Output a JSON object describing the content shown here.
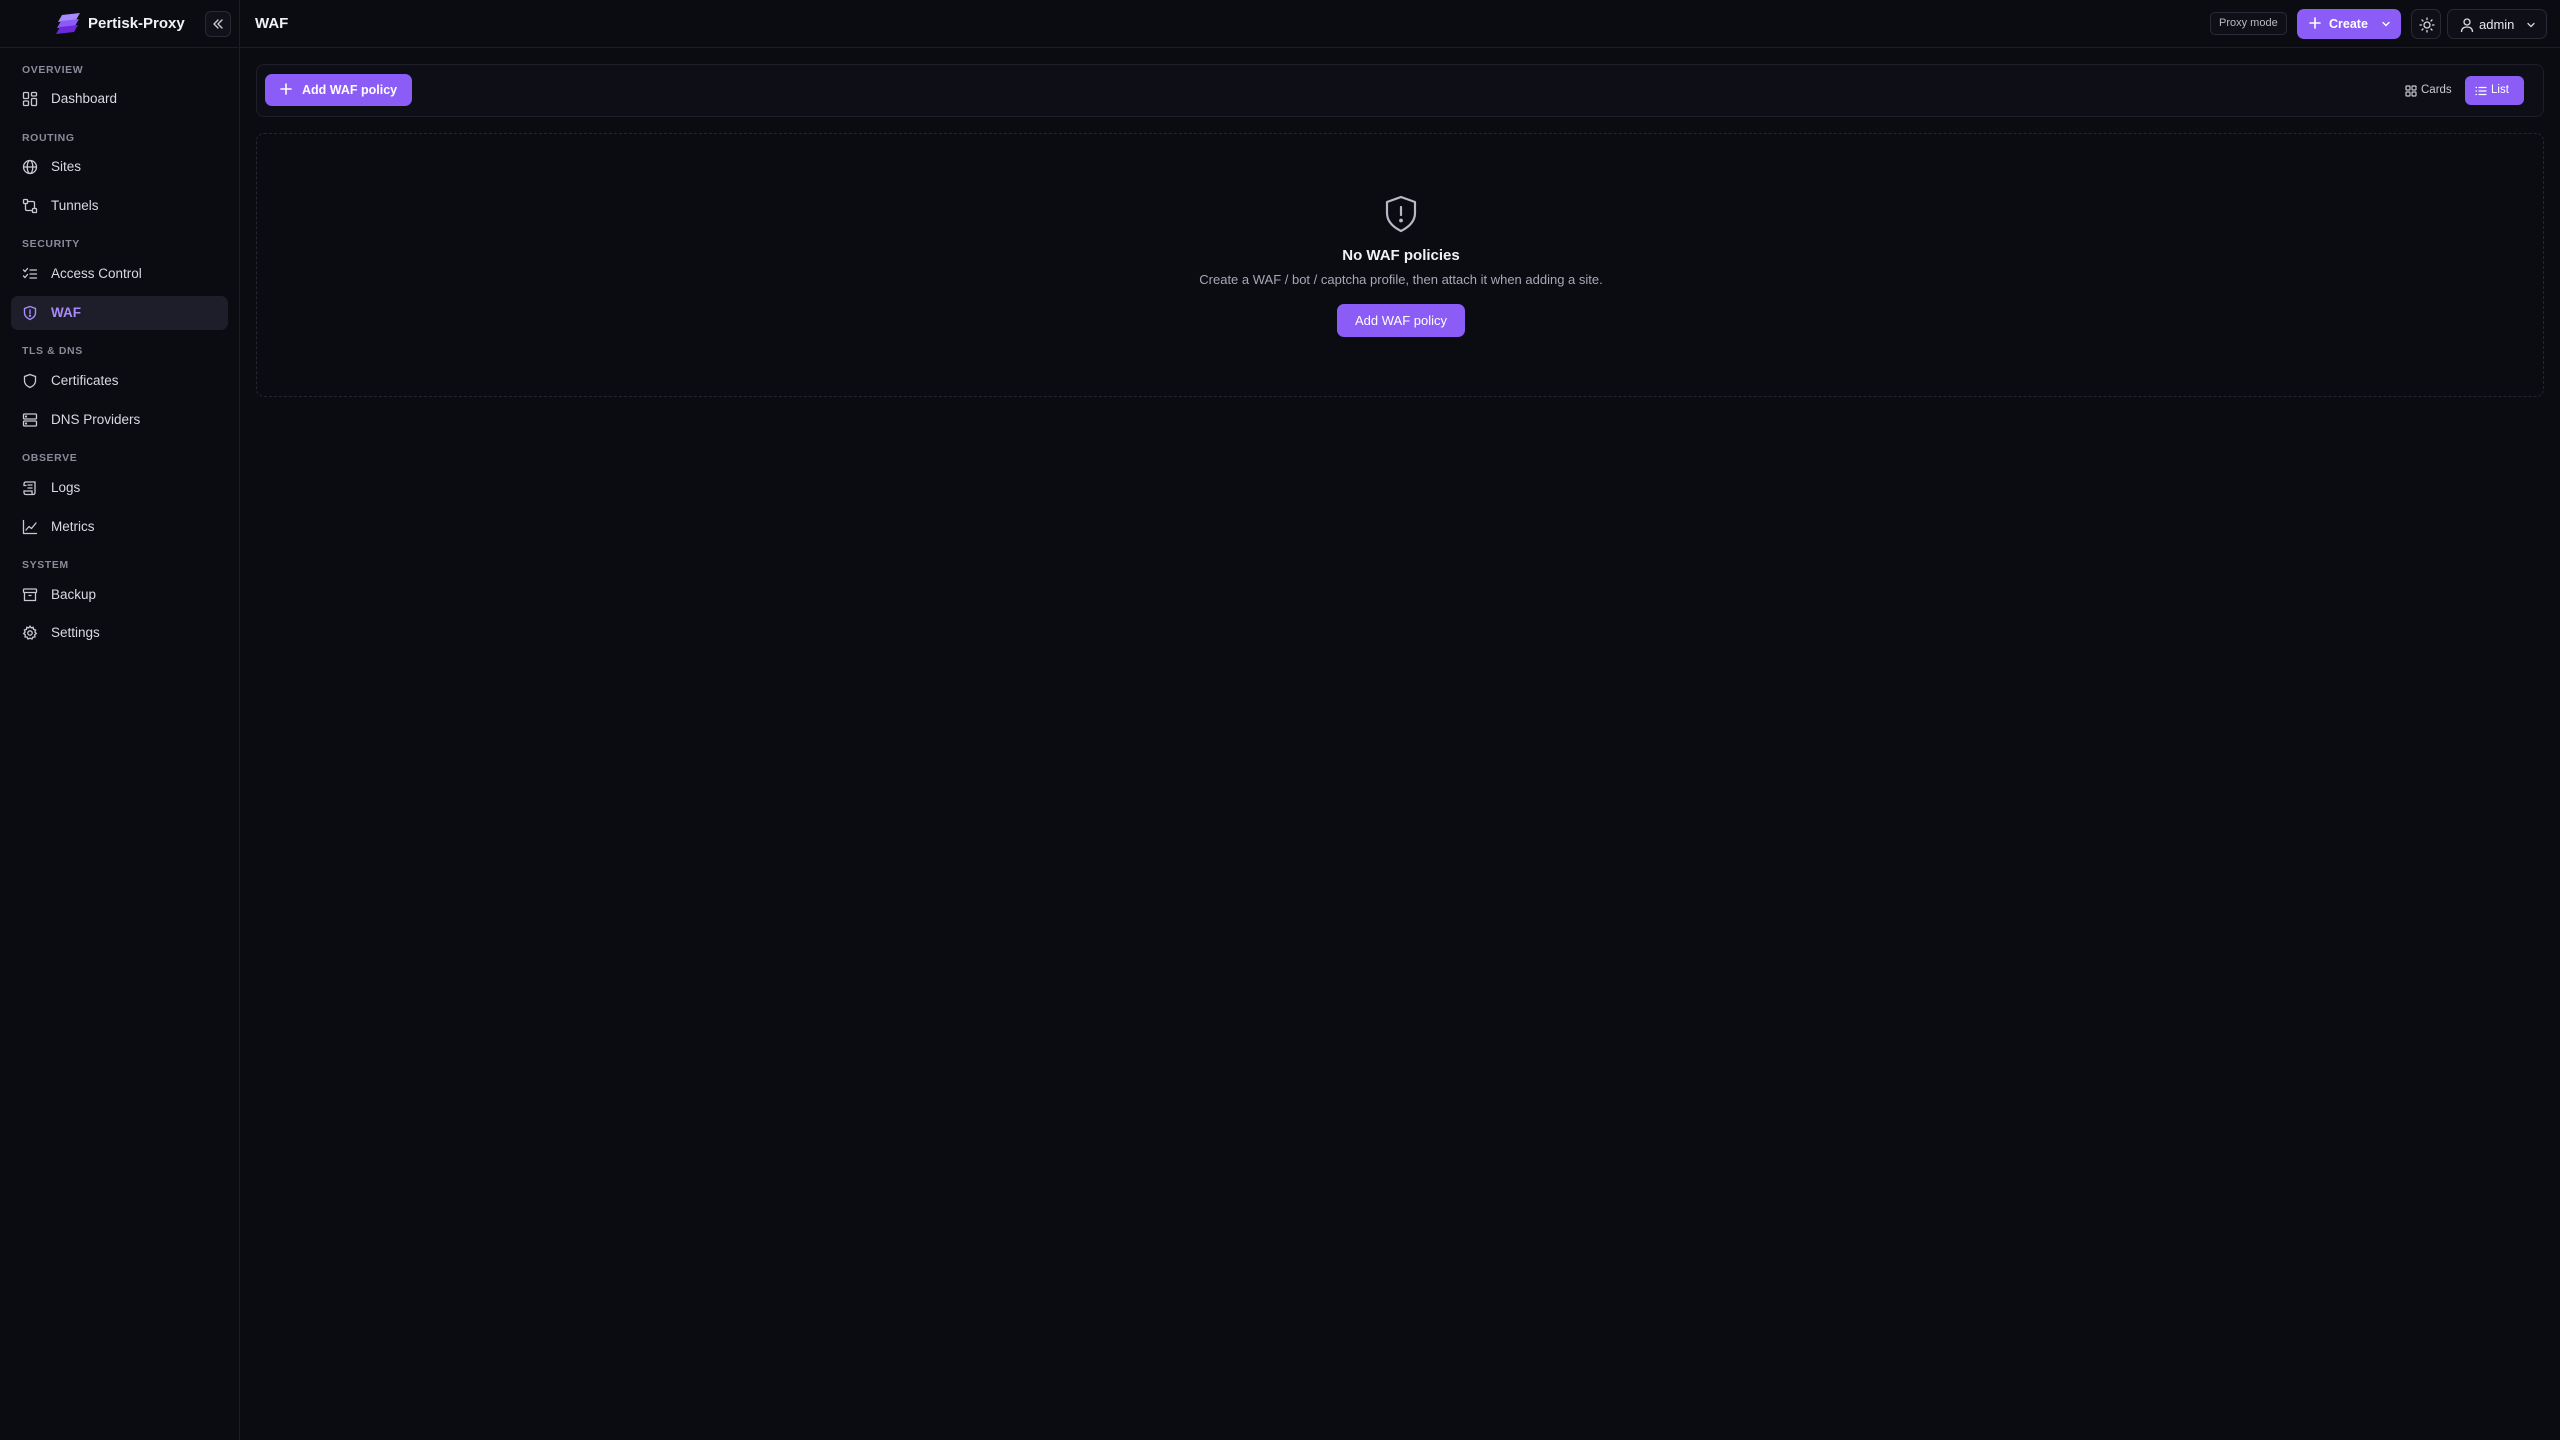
{
  "app": {
    "name": "Pertisk-Proxy"
  },
  "header": {
    "title": "WAF",
    "proxy_mode": "Proxy mode",
    "create_label": "Create",
    "user": "admin"
  },
  "sidebar": {
    "sections": [
      {
        "label": "OVERVIEW",
        "items": [
          {
            "label": "Dashboard",
            "icon": "dashboard-icon"
          }
        ]
      },
      {
        "label": "ROUTING",
        "items": [
          {
            "label": "Sites",
            "icon": "globe-icon"
          },
          {
            "label": "Tunnels",
            "icon": "tunnel-icon"
          }
        ]
      },
      {
        "label": "SECURITY",
        "items": [
          {
            "label": "Access Control",
            "icon": "list-checks-icon"
          },
          {
            "label": "WAF",
            "icon": "shield-icon",
            "active": true
          }
        ]
      },
      {
        "label": "TLS & DNS",
        "items": [
          {
            "label": "Certificates",
            "icon": "shield-outline-icon"
          },
          {
            "label": "DNS Providers",
            "icon": "server-icon"
          }
        ]
      },
      {
        "label": "OBSERVE",
        "items": [
          {
            "label": "Logs",
            "icon": "scroll-icon"
          },
          {
            "label": "Metrics",
            "icon": "line-chart-icon"
          }
        ]
      },
      {
        "label": "SYSTEM",
        "items": [
          {
            "label": "Backup",
            "icon": "archive-icon"
          },
          {
            "label": "Settings",
            "icon": "gear-icon"
          }
        ]
      }
    ]
  },
  "toolbar": {
    "add_label": "Add WAF policy",
    "view_cards": "Cards",
    "view_list": "List",
    "active_view": "List"
  },
  "empty_state": {
    "title": "No WAF policies",
    "description": "Create a WAF / bot / captcha profile, then attach it when adding a site.",
    "button": "Add WAF policy"
  },
  "colors": {
    "accent": "#8b5cf6",
    "accent_text": "#a78bfa",
    "background": "#0b0b12",
    "border": "#1d1d27"
  }
}
